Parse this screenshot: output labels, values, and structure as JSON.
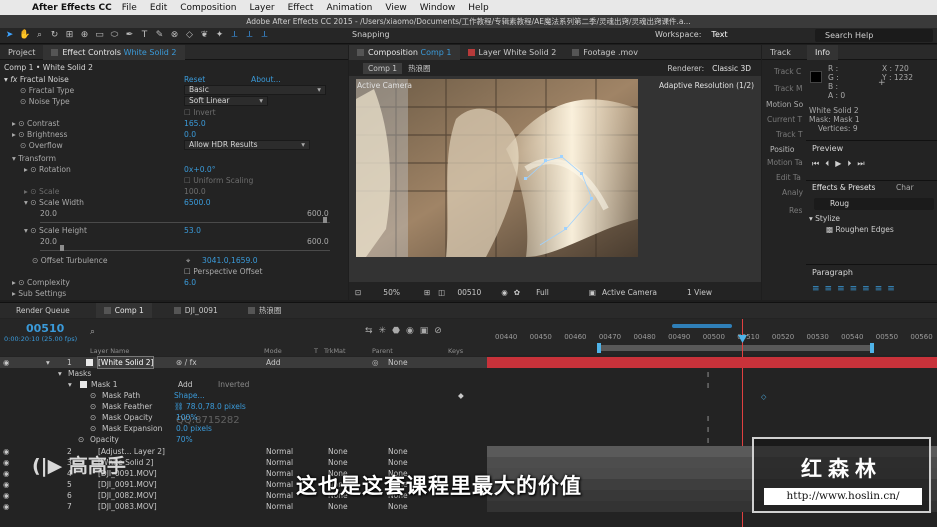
{
  "menubar": {
    "app": "After Effects CC",
    "items": [
      "File",
      "Edit",
      "Composition",
      "Layer",
      "Effect",
      "Animation",
      "View",
      "Window",
      "Help"
    ]
  },
  "window_title": "Adobe After Effects CC 2015 - /Users/xiaomo/Documents/工作教程/专辑素教程/AE魔法系列第二季/灵魂出窍/灵魂出窍课件.a...",
  "toolbar": {
    "snapping": "Snapping",
    "workspace_label": "Workspace:",
    "workspace_value": "Text",
    "search_help": "Search Help"
  },
  "left_panel": {
    "tab_project": "Project",
    "tab_effect_controls": "Effect Controls",
    "layer_name": "White Solid 2",
    "breadcrumb": "Comp 1 • White Solid 2"
  },
  "effect": {
    "name": "Fractal Noise",
    "reset": "Reset",
    "about": "About...",
    "props": [
      {
        "label": "Fractal Type",
        "value": "Basic"
      },
      {
        "label": "Noise Type",
        "value": "Soft Linear"
      },
      {
        "label": "",
        "value": "Invert"
      },
      {
        "label": "Contrast",
        "value": "165.0"
      },
      {
        "label": "Brightness",
        "value": "0.0"
      },
      {
        "label": "Overflow",
        "value": "Allow HDR Results"
      },
      {
        "label": "Transform",
        "value": ""
      },
      {
        "label": "Rotation",
        "value": "0x+0.0°"
      },
      {
        "label": "",
        "value": "Uniform Scaling"
      },
      {
        "label": "Scale",
        "value": "100.0"
      },
      {
        "label": "Scale Width",
        "value": "6500.0"
      },
      {
        "label": "20.0",
        "value": "600.0"
      },
      {
        "label": "Scale Height",
        "value": "53.0"
      },
      {
        "label": "20.0",
        "value": "600.0"
      },
      {
        "label": "Offset Turbulence",
        "value": "3041.0,1659.0"
      },
      {
        "label": "",
        "value": "Perspective Offset"
      },
      {
        "label": "Complexity",
        "value": "6.0"
      },
      {
        "label": "Sub Settings",
        "value": ""
      }
    ]
  },
  "comp_panel": {
    "tab_composition": "Composition",
    "comp_name": "Comp 1",
    "tab_layer": "Layer White Solid 2",
    "tab_footage": "Footage .mov",
    "sub_tab": "Comp 1",
    "sub_tab2": "热浪圈",
    "renderer_label": "Renderer:",
    "renderer": "Classic 3D",
    "active_camera": "Active Camera",
    "adaptive": "Adaptive Resolution (1/2)",
    "zoom": "50%",
    "timecode": "00510",
    "resolution": "Full",
    "camera_select": "Active Camera",
    "views": "1 View"
  },
  "info_panel": {
    "track_tab": "Track",
    "info_tab": "Info",
    "r": "R :",
    "g": "G :",
    "b": "B :",
    "a": "A : 0",
    "x": "X : 720",
    "y": "Y : 1232",
    "layer": "White Solid 2",
    "mask": "Mask: Mask 1",
    "vertices": "Vertices: 9",
    "tracker_labels": [
      "Track C",
      "Track M",
      "Motion So",
      "Current T",
      "Track T",
      "Positio",
      "Motion Ta",
      "Edit Ta",
      "Analy",
      "Res"
    ]
  },
  "preview_panel": {
    "title": "Preview"
  },
  "effects_presets": {
    "tab": "Effects & Presets",
    "tab2": "Char",
    "search": "Roug",
    "category": "Stylize",
    "item": "Roughen Edges"
  },
  "paragraph_panel": {
    "title": "Paragraph"
  },
  "timeline": {
    "tabs": [
      "Render Queue",
      "Comp 1",
      "DJI_0091",
      "热浪圈"
    ],
    "timecode": "00510",
    "timecode_sub": "0:00:20:10 (25.00 fps)",
    "search_placeholder": "",
    "col_layer_name": "Layer Name",
    "col_mode": "Mode",
    "col_t": "T",
    "col_trkmat": "TrkMat",
    "col_parent": "Parent",
    "col_keys": "Keys",
    "ruler_ticks": [
      "00440",
      "00450",
      "00460",
      "00470",
      "00480",
      "00490",
      "00500",
      "00510",
      "00520",
      "00530",
      "00540",
      "00550",
      "00560"
    ],
    "layers": [
      {
        "num": "1",
        "name": "[White Solid 2]",
        "mode": "Add",
        "trk": "",
        "parent": "None",
        "color": "#e8e8e8"
      },
      {
        "num": "2",
        "name": "[Adjust... Layer 2]",
        "mode": "Normal",
        "trk": "None",
        "parent": "None",
        "color": "#e8e8e8"
      },
      {
        "num": "3",
        "name": "[White Solid 2]",
        "mode": "Normal",
        "trk": "None",
        "parent": "None",
        "color": "#e8e8e8"
      },
      {
        "num": "4",
        "name": "[DJI_0091.MOV]",
        "mode": "Normal",
        "trk": "None",
        "parent": "None",
        "color": "#9aa6b0"
      },
      {
        "num": "5",
        "name": "[DJI_0091.MOV]",
        "mode": "Normal",
        "trk": "None",
        "parent": "None",
        "color": "#9aa6b0"
      },
      {
        "num": "6",
        "name": "[DJI_0082.MOV]",
        "mode": "Normal",
        "trk": "None",
        "parent": "None",
        "color": "#9aa6b0"
      },
      {
        "num": "7",
        "name": "[DJI_0083.MOV]",
        "mode": "Normal",
        "trk": "None",
        "parent": "None",
        "color": "#9aa6b0"
      }
    ],
    "masks_label": "Masks",
    "mask1": "Mask 1",
    "mask1_mode": "Add",
    "mask1_inverted": "Inverted",
    "mask_props": [
      {
        "label": "Mask Path",
        "value": "Shape..."
      },
      {
        "label": "Mask Feather",
        "value": "78.0,78.0 pixels"
      },
      {
        "label": "Mask Opacity",
        "value": "100%"
      },
      {
        "label": "Mask Expansion",
        "value": "0.0 pixels"
      }
    ],
    "opacity_label": "Opacity",
    "opacity_value": "70%"
  },
  "overlay": {
    "subtitle": "这也是这套课程里最大的价值",
    "watermark_cn": "红森林",
    "watermark_url": "http://www.hoslin.cn/",
    "logo": "高高手",
    "faint_text": "QQ:8715282"
  },
  "colors": {
    "accent_blue": "#3a9ad9",
    "layer_red_bar": "#c8323a",
    "track_gray": "#5a5a5a"
  }
}
